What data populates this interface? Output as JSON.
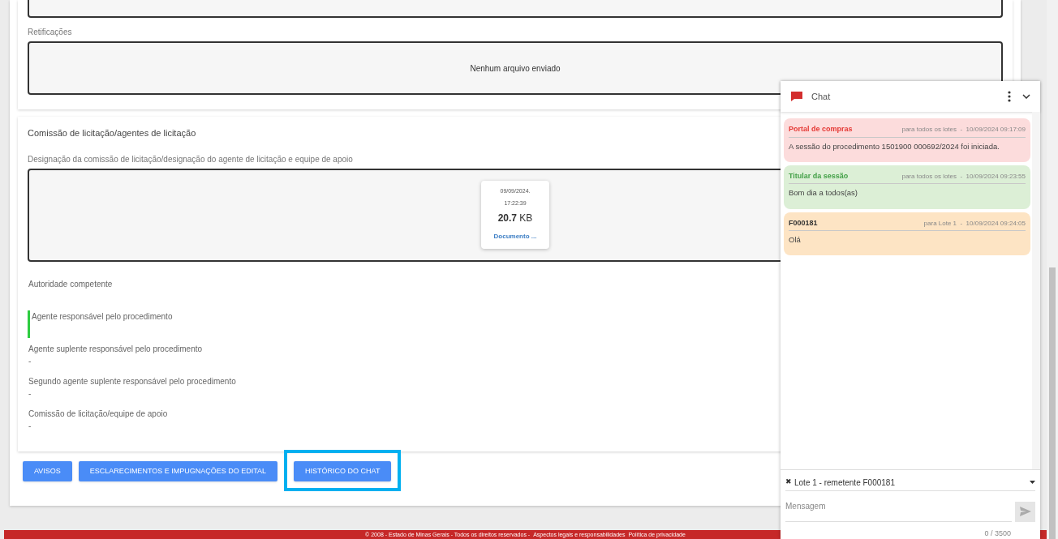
{
  "sections": [
    {
      "partial": true,
      "label": "Retificações",
      "empty_text": "Nenhum arquivo enviado"
    },
    {
      "partial": false,
      "title": "Comissão de licitação/agentes de licitação",
      "label": "Designação da comissão de licitação/designação do agente de licitação e equipe de apoio",
      "file": {
        "date": "09/09/2024.",
        "time": "17:22:39",
        "size": "20.7",
        "unit": "KB",
        "name": "Documento ..."
      },
      "fields": [
        {
          "label": "Autoridade competente",
          "marked": false
        },
        {
          "label": "Agente responsável pelo procedimento",
          "marked": true
        },
        {
          "label": "Agente suplente responsável pelo procedimento",
          "value": "-",
          "marked": false
        },
        {
          "label": "Segundo agente suplente responsável pelo procedimento",
          "value": "-",
          "marked": false
        },
        {
          "label": "Comissão de licitação/equipe de apoio",
          "value": "-",
          "marked": false
        }
      ]
    }
  ],
  "buttons": [
    {
      "label": "AVISOS",
      "highlighted": false
    },
    {
      "label": "ESCLARECIMENTOS E IMPUGNAÇÕES DO EDITAL",
      "highlighted": false
    },
    {
      "label": "HISTÓRICO DO CHAT",
      "highlighted": true
    }
  ],
  "chat": {
    "title": "Chat",
    "messages": [
      {
        "kind": "portal",
        "sender": "Portal de compras",
        "meta": "para todos os lotes  -  10/09/2024 09:17:09",
        "text": "A sessão do procedimento 1501900 000692/2024 foi iniciada."
      },
      {
        "kind": "host",
        "sender": "Titular da sessão",
        "meta": "para todos os lotes  -  10/09/2024 09:23:55",
        "text": "Bom dia a todos(as)"
      },
      {
        "kind": "supplier",
        "sender": "F000181",
        "meta": "para Lote 1  -  10/09/2024 09:24:05",
        "text": "Olá"
      }
    ],
    "recipient": {
      "clear": "✖",
      "label": "Lote 1 - remetente F000181"
    },
    "message": {
      "placeholder": "Mensagem"
    },
    "counter": "0 / 3500"
  },
  "footer": {
    "text": "© 2008 - Estado de Minas Gerais - Todos os direitos reservados -",
    "links": [
      "Aspectos legais e responsabilidades",
      "Política de privacidade"
    ]
  }
}
